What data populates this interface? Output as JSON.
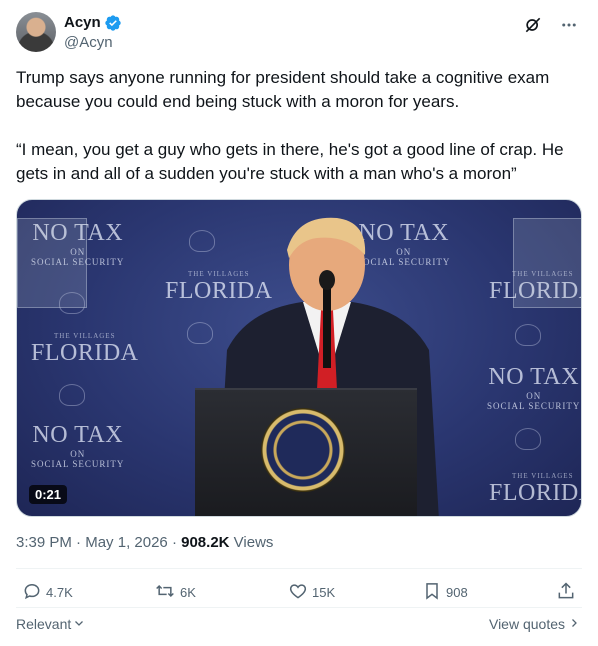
{
  "author": {
    "display_name": "Acyn",
    "handle": "@Acyn",
    "verified": true
  },
  "icons": {
    "verified": "verified-badge-icon",
    "grok": "grok-icon",
    "more": "more-icon",
    "reply": "reply-icon",
    "retweet": "retweet-icon",
    "like": "like-icon",
    "bookmark": "bookmark-icon",
    "share": "share-icon",
    "chevron_down": "chevron-down-icon",
    "chevron_right": "chevron-right-icon"
  },
  "colors": {
    "verified_blue": "#1d9bf0",
    "text_primary": "#0f1419",
    "text_secondary": "#536471"
  },
  "tweet": {
    "paragraph1": "Trump says anyone running for president should take a cognitive exam because you could end being stuck with a moron for years.",
    "paragraph2": "“I mean, you get a guy who gets in there, he's got a good line of crap. He gets in and all of a sudden you're stuck with a man who's a moron”"
  },
  "media": {
    "duration": "0:21",
    "backdrop": {
      "no_tax": "NO TAX",
      "on": "ON",
      "social_security": "SOCIAL SECURITY",
      "the_villages": "THE VILLAGES",
      "florida": "FLORIDA"
    },
    "seal_text": "PRESIDENT OF THE UNITED STATES"
  },
  "meta": {
    "time": "3:39 PM",
    "date": "May 1, 2026",
    "views_count": "908.2K",
    "views_label": "Views"
  },
  "actions": {
    "replies": "4.7K",
    "reposts": "6K",
    "likes": "15K",
    "bookmarks": "908"
  },
  "footer": {
    "sort_label": "Relevant",
    "view_quotes": "View quotes"
  }
}
